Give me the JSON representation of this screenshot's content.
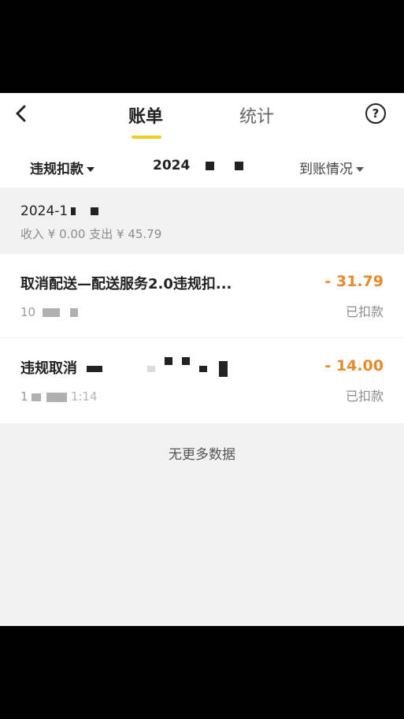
{
  "header": {
    "tabs": [
      {
        "label": "账单",
        "active": true
      },
      {
        "label": "统计",
        "active": false
      }
    ],
    "help_glyph": "?",
    "icons": {
      "back": "chevron-left-icon",
      "help": "question-circle-icon"
    }
  },
  "filters": {
    "type_label": "违规扣款",
    "date_label": "2024",
    "status_label": "到账情况"
  },
  "summary": {
    "date": "2024-1",
    "totals": "收入 ¥ 0.00 支出 ¥ 45.79"
  },
  "transactions": [
    {
      "title": "取消配送—配送服务2.0违规扣...",
      "time": "10",
      "amount": "- 31.79",
      "status": "已扣款"
    },
    {
      "title": "违规取消",
      "time": "1",
      "time_suffix": "1:14",
      "amount": "- 14.00",
      "status": "已扣款"
    }
  ],
  "footer": {
    "no_more": "无更多数据"
  },
  "colors": {
    "accent": "#f5cd1f",
    "amount": "#e8892b",
    "background": "#f2f2f2"
  }
}
